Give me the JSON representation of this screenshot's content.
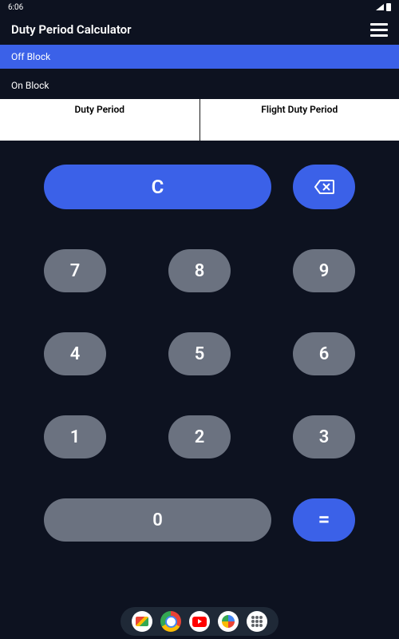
{
  "status_bar": {
    "time": "6:06"
  },
  "app_bar": {
    "title": "Duty Period Calculator"
  },
  "fields": {
    "off_block_label": "Off Block",
    "on_block_label": "On Block"
  },
  "results": {
    "duty_period_label": "Duty Period",
    "flight_duty_period_label": "Flight Duty Period"
  },
  "keypad": {
    "clear": "C",
    "key7": "7",
    "key8": "8",
    "key9": "9",
    "key4": "4",
    "key5": "5",
    "key6": "6",
    "key1": "1",
    "key2": "2",
    "key3": "3",
    "key0": "0",
    "equals": "="
  }
}
